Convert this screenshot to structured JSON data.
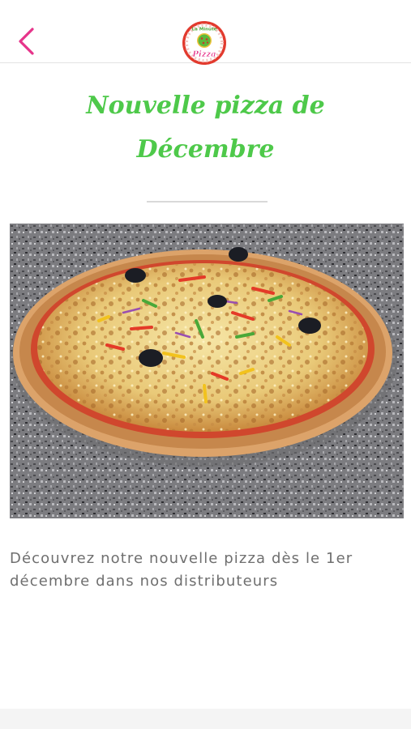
{
  "header": {
    "back_icon": "chevron-left-icon",
    "back_color": "#e6348a",
    "logo_text_top": "La Minute",
    "logo_text_bottom": "Pizza"
  },
  "article": {
    "title": "Nouvelle pizza de Décembre",
    "title_color": "#4ec94a",
    "image_subject": "pizza-photo",
    "description": "Découvrez notre nouvelle pizza dès le 1er décembre dans nos distributeurs"
  }
}
